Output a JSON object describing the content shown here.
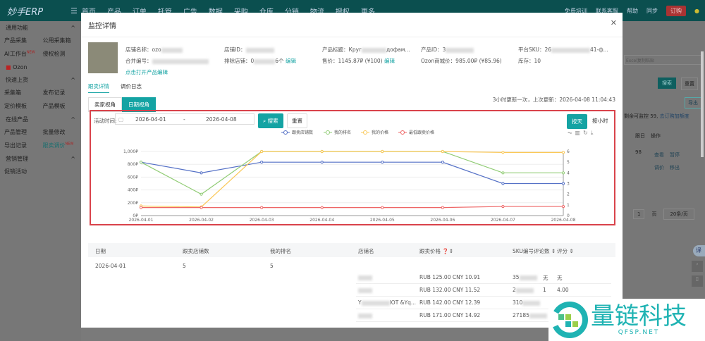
{
  "app": {
    "logo": "妙手ERP",
    "nav": [
      "首页",
      "产品",
      "订单",
      "托管",
      "广告",
      "数据",
      "采购",
      "仓库",
      "分销",
      "物流",
      "授权",
      "更多"
    ],
    "top_links": [
      "免费培训",
      "联系客服",
      "帮助",
      "同步"
    ],
    "buy": "订购"
  },
  "sidebar": {
    "sections": [
      {
        "title": "通用功能",
        "items": [
          "产品采集",
          "公用采集箱",
          "AI工作台",
          "侵权检测"
        ]
      },
      {
        "title": "Ozon",
        "items": []
      },
      {
        "title": "快速上货",
        "items": [
          "采集箱",
          "发布记录",
          "定价模板",
          "产品模板"
        ]
      },
      {
        "title": "在线产品",
        "items": [
          "产品管理",
          "批量修改",
          "导出记录",
          "跟卖调价"
        ]
      },
      {
        "title": "营销管理",
        "items": [
          "促销活动"
        ]
      }
    ],
    "new_badge": "NEW"
  },
  "modal": {
    "title": "监控详情",
    "info": {
      "store_name": "店铺名称：ozo",
      "store_id": "店铺ID：",
      "product_title": "产品标题：Круг",
      "product_title_tail": "дофам...",
      "product_id": "产品ID：3",
      "platform_sku": "平台SKU：26",
      "platform_sku_tail": "41-ф...",
      "merge_no": "合并编号：",
      "exclude_stores": "排除店铺：0",
      "exclude_tail": "6个",
      "edit": "编辑",
      "price": "售价：1145.87₽ (¥100)",
      "ozon_price": "Ozon商城价：985.00₽ (¥85.96)",
      "stock": "库存：10",
      "open_edit": "点击打开产品编辑"
    },
    "tabs": [
      "跟卖详情",
      "调价日志"
    ],
    "views": [
      "卖家视角",
      "日期视角"
    ],
    "update_note": "3小时更新一次，上次更新：2026-04-08 11:04:43",
    "filter": {
      "label": "活动时间:",
      "start": "2026-04-01",
      "sep": "-",
      "end": "2026-04-08",
      "search": "搜索",
      "reset": "重置",
      "by_day": "按天",
      "by_hour": "按小时"
    },
    "table": {
      "headers": [
        "日期",
        "跟卖店铺数",
        "我的排名",
        "店铺名",
        "跟卖价格",
        "SKU编号",
        "评论数",
        "评分"
      ],
      "row": {
        "date": "2026-04-01",
        "count": "5",
        "rank": "5"
      },
      "sellers": [
        {
          "name": "",
          "price": "RUB 125.00 CNY 10.91",
          "sku": "35",
          "reviews": "无",
          "rating": "无"
        },
        {
          "name": "",
          "price": "RUB 132.00 CNY 11.52",
          "sku": "2",
          "reviews": "1",
          "rating": "4.00"
        },
        {
          "name": "Y",
          "name_tail": "IOT &Yq...",
          "price": "RUB 142.00 CNY 12.39",
          "sku": "310",
          "reviews": "",
          "rating": "无"
        },
        {
          "name": "",
          "price": "RUB 171.00 CNY 14.92",
          "sku": "27185",
          "reviews": "",
          "rating": ""
        }
      ]
    }
  },
  "right_panel": {
    "placeholder": "Excel复制粘贴",
    "search": "搜索",
    "reset": "重置",
    "export": "导出",
    "remaining": "剩余可监控 59,",
    "buy_more": "去订购加额度",
    "col1": "跟日",
    "col2": "操作",
    "val": "98",
    "actions": [
      "查看",
      "暂停",
      "调价",
      "移出"
    ],
    "page": "1",
    "page_unit": "页",
    "page_size": "20条/页",
    "translate": "译"
  },
  "watermark": {
    "text": "量链科技",
    "sub": "QFSP.NET"
  },
  "chart_data": {
    "type": "line",
    "categories": [
      "2026-04-01",
      "2026-04-02",
      "2026-04-03",
      "2026-04-04",
      "2026-04-05",
      "2026-04-06",
      "2026-04-07",
      "2026-04-08"
    ],
    "y_left": {
      "ticks": [
        "0₽",
        "200₽",
        "400₽",
        "600₽",
        "800₽",
        "1,000₽"
      ],
      "range": [
        0,
        1000
      ]
    },
    "y_right": {
      "ticks": [
        "0",
        "1",
        "2",
        "3",
        "4",
        "5",
        "6"
      ],
      "range": [
        0,
        6
      ]
    },
    "legend_position": "top",
    "grid": true,
    "series": [
      {
        "name": "跟卖店铺数",
        "axis": "right",
        "color": "#5470c6",
        "values": [
          5,
          4,
          5,
          5,
          5,
          5,
          3,
          3
        ]
      },
      {
        "name": "我的排名",
        "axis": "right",
        "color": "#91cc75",
        "values": [
          5,
          2,
          6,
          6,
          6,
          6,
          4,
          4
        ]
      },
      {
        "name": "我的价格",
        "axis": "left",
        "color": "#fac858",
        "values": [
          150,
          135,
          1000,
          1000,
          1000,
          1000,
          985,
          985
        ]
      },
      {
        "name": "最低跟卖价格",
        "axis": "left",
        "color": "#ee6666",
        "values": [
          125,
          125,
          125,
          125,
          125,
          125,
          142,
          142
        ]
      }
    ]
  }
}
